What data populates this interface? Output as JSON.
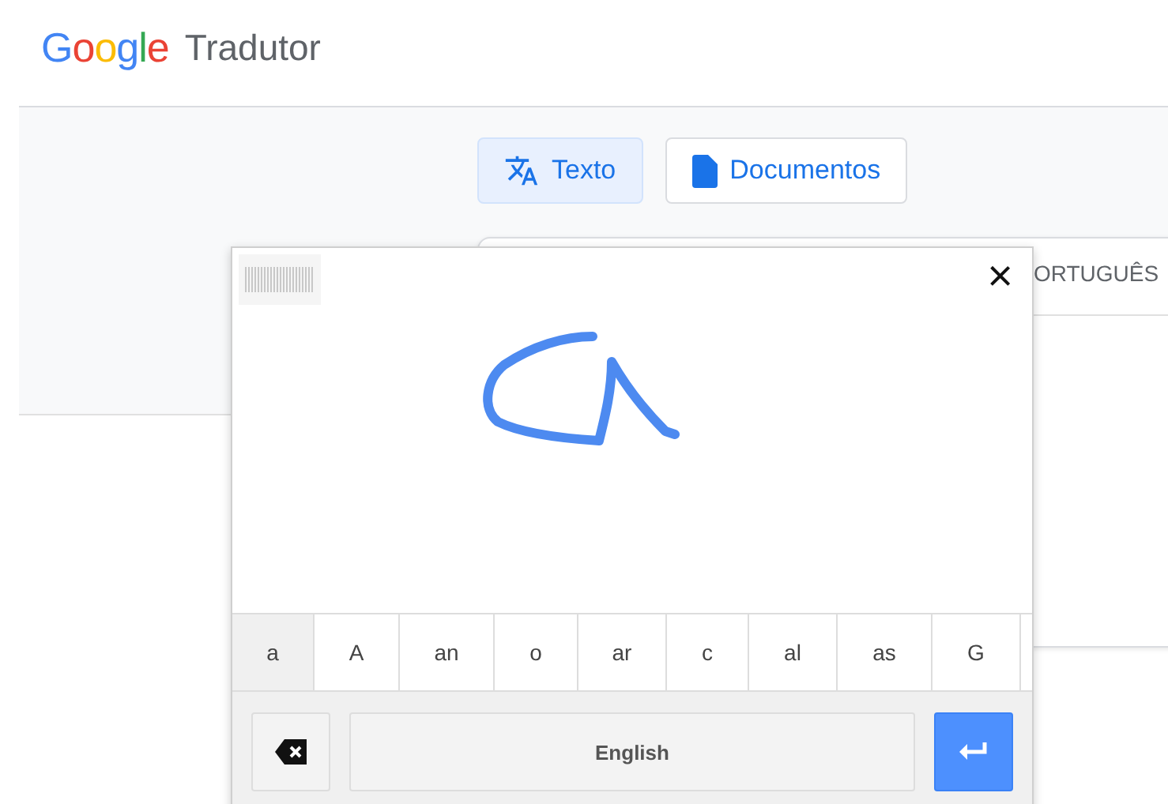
{
  "header": {
    "logo": "Google",
    "product": "Tradutor"
  },
  "tabs": [
    {
      "label": "Texto",
      "kind": "text",
      "selected": true
    },
    {
      "label": "Documentos",
      "kind": "document",
      "selected": false
    }
  ],
  "translation_card": {
    "target_language": "ORTUGUÊS"
  },
  "handwriting_panel": {
    "close": "×",
    "candidates": [
      {
        "label": "a",
        "selected": true
      },
      {
        "label": "A",
        "selected": false
      },
      {
        "label": "an",
        "selected": false
      },
      {
        "label": "o",
        "selected": false
      },
      {
        "label": "ar",
        "selected": false
      },
      {
        "label": "c",
        "selected": false
      },
      {
        "label": "al",
        "selected": false
      },
      {
        "label": "as",
        "selected": false
      },
      {
        "label": "G",
        "selected": false
      }
    ],
    "language_button": "English"
  }
}
